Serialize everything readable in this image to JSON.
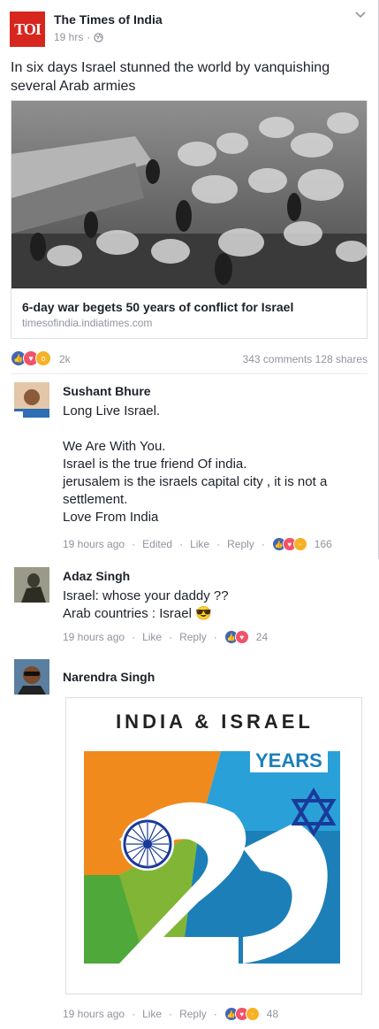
{
  "post": {
    "page_name": "The Times of India",
    "logo_text": "TOI",
    "time": "19 hrs",
    "text": "In six days Israel stunned the world by vanquishing several Arab armies",
    "link": {
      "title": "6-day war begets 50 years of conflict for Israel",
      "domain": "timesofindia.indiatimes.com"
    },
    "reactions_count": "2k",
    "comments_count": "343 comments",
    "shares_count": "128 shares"
  },
  "comments": [
    {
      "name": "Sushant Bhure",
      "text": "Long Live Israel.\n\nWe Are With You.\nIsrael is the true friend Of india.\njerusalem is the israels capital city , it is not a settlement.\nLove From India",
      "time": "19 hours ago",
      "edited": "Edited",
      "like": "Like",
      "reply": "Reply",
      "reaction_count": "166"
    },
    {
      "name": "Adaz Singh",
      "text": "Israel: whose your daddy ??\nArab countries  : Israel 😎",
      "time": "19 hours ago",
      "like": "Like",
      "reply": "Reply",
      "reaction_count": "24"
    },
    {
      "name": "Narendra Singh",
      "time": "19 hours ago",
      "like": "Like",
      "reply": "Reply",
      "reaction_count": "48",
      "image": {
        "title": "INDIA & ISRAEL",
        "years": "YEARS",
        "number": "25"
      }
    }
  ],
  "colors": {
    "toi_red": "#d7261e",
    "like_blue": "#4267b2",
    "love_red": "#f25268",
    "wow_yellow": "#f7b125",
    "meta_gray": "#90949c"
  }
}
